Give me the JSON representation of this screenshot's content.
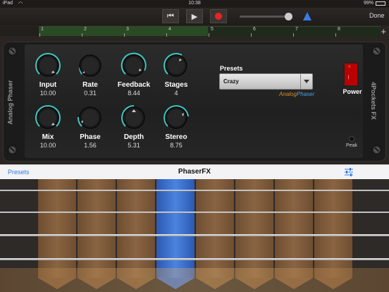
{
  "status": {
    "carrier": "iPad",
    "time": "10:38",
    "battery": "99%"
  },
  "toolbar": {
    "done_label": "Done"
  },
  "ruler": {
    "marks": [
      "1",
      "2",
      "3",
      "4",
      "5",
      "6",
      "7",
      "8"
    ]
  },
  "plugin": {
    "left_label": "Analog Phaser",
    "right_label": "4Pockets FX",
    "knobs": [
      {
        "label": "Input",
        "value": "10.00"
      },
      {
        "label": "Rate",
        "value": "0.31"
      },
      {
        "label": "Feedback",
        "value": "8.44"
      },
      {
        "label": "Stages",
        "value": "4"
      },
      {
        "label": "Mix",
        "value": "10.00"
      },
      {
        "label": "Phase",
        "value": "1.56"
      },
      {
        "label": "Depth",
        "value": "5.31"
      },
      {
        "label": "Stereo",
        "value": "8.75"
      }
    ],
    "presets_title": "Presets",
    "preset_selected": "Crazy",
    "brand_a": "Analog",
    "brand_b": "Phaser",
    "power_label": "Power",
    "peak_label": "Peak"
  },
  "navbar": {
    "left": "Presets",
    "title": "PhaserFX"
  },
  "colors": {
    "accent": "#2f7ae5",
    "knob_ring": "#3ec7c2",
    "brand_orange": "#d68a2a",
    "brand_blue": "#4a9ee0",
    "power": "#bb0000",
    "fret_selected": "#3b6fce"
  }
}
